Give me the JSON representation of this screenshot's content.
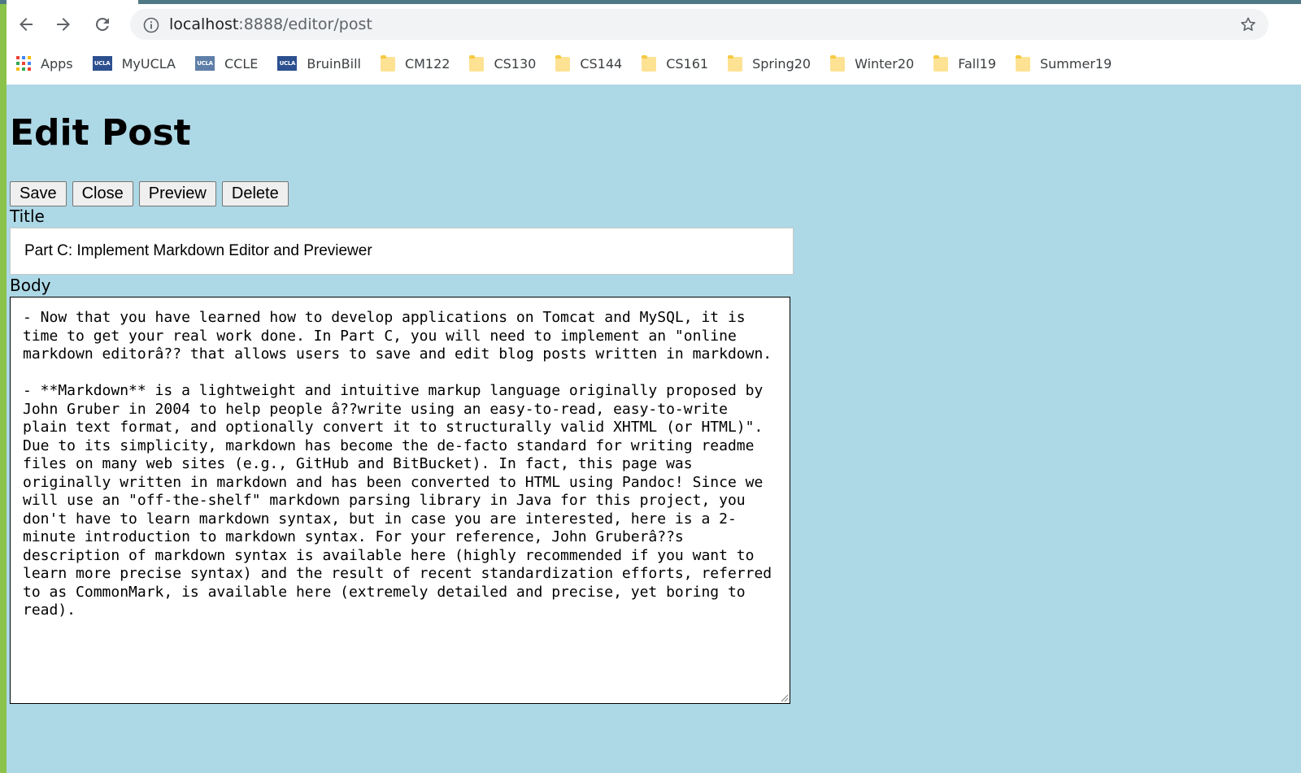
{
  "browser": {
    "url_host": "localhost",
    "url_rest": ":8888/editor/post",
    "bookmarks": [
      {
        "label": "Apps",
        "icon": "apps-grid-icon"
      },
      {
        "label": "MyUCLA",
        "icon": "ucla-icon"
      },
      {
        "label": "CCLE",
        "icon": "ucla-icon"
      },
      {
        "label": "BruinBill",
        "icon": "ucla-icon"
      },
      {
        "label": "CM122",
        "icon": "folder-icon"
      },
      {
        "label": "CS130",
        "icon": "folder-icon"
      },
      {
        "label": "CS144",
        "icon": "folder-icon"
      },
      {
        "label": "CS161",
        "icon": "folder-icon"
      },
      {
        "label": "Spring20",
        "icon": "folder-icon"
      },
      {
        "label": "Winter20",
        "icon": "folder-icon"
      },
      {
        "label": "Fall19",
        "icon": "folder-icon"
      },
      {
        "label": "Summer19",
        "icon": "folder-icon"
      }
    ],
    "ucla_icon_text": "UCLA"
  },
  "page": {
    "heading": "Edit Post",
    "buttons": {
      "save": "Save",
      "close": "Close",
      "preview": "Preview",
      "delete": "Delete"
    },
    "title_label": "Title",
    "title_value": "Part C: Implement Markdown Editor and Previewer",
    "body_label": "Body",
    "body_value": "- Now that you have learned how to develop applications on Tomcat and MySQL, it is time to get your real work done. In Part C, you will need to implement an \"online markdown editorâ?? that allows users to save and edit blog posts written in markdown.\n\n- **Markdown** is a lightweight and intuitive markup language originally proposed by John Gruber in 2004 to help people â??write using an easy-to-read, easy-to-write plain text format, and optionally convert it to structurally valid XHTML (or HTML)\". Due to its simplicity, markdown has become the de-facto standard for writing readme files on many web sites (e.g., GitHub and BitBucket). In fact, this page was originally written in markdown and has been converted to HTML using Pandoc! Since we will use an \"off-the-shelf\" markdown parsing library in Java for this project, you don't have to learn markdown syntax, but in case you are interested, here is a 2-minute introduction to markdown syntax. For your reference, John Gruberâ??s description of markdown syntax is available here (highly recommended if you want to learn more precise syntax) and the result of recent standardization efforts, referred to as CommonMark, is available here (extremely detailed and precise, yet boring to read)."
  },
  "colors": {
    "page_background": "#add8e6",
    "left_strip": "#8bc34a",
    "button_bg": "#efefef"
  }
}
